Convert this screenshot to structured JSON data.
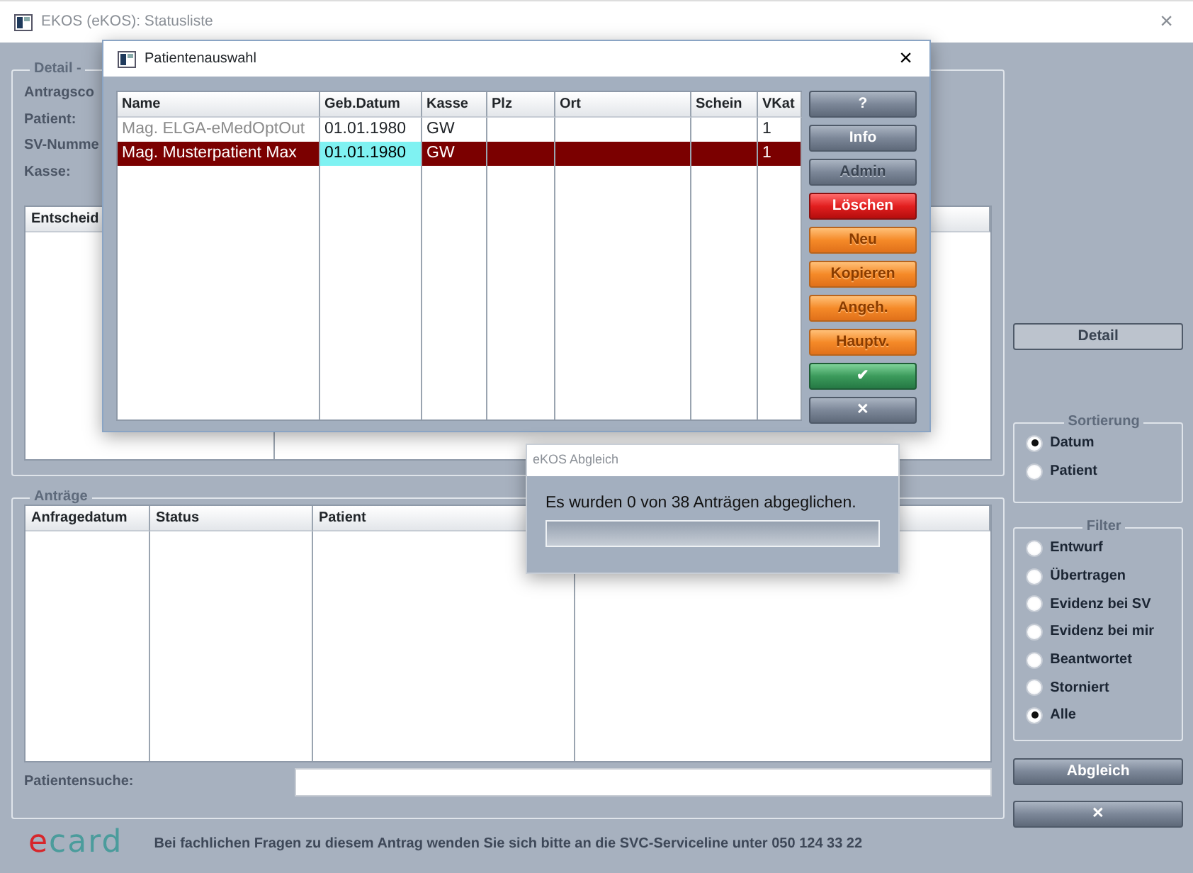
{
  "window": {
    "title": "EKOS (eKOS): Statusliste",
    "close": "×"
  },
  "detail_group": {
    "legend": "Detail -",
    "labels": [
      "Antragsco",
      "Patient:",
      "SV-Numme",
      "Kasse:"
    ],
    "table": {
      "columns": [
        "Entscheid"
      ]
    }
  },
  "antraege_group": {
    "legend": "Anträge",
    "table": {
      "columns": [
        "Anfragedatum",
        "Status",
        "Patient"
      ]
    },
    "search": {
      "label": "Patientensuche:"
    }
  },
  "footer": {
    "logo": "ecard",
    "text": "Bei fachlichen Fragen zu diesem Antrag wenden Sie sich bitte an die SVC-Serviceline unter 050 124 33 22"
  },
  "side": {
    "detail_button": {
      "label": "Detail",
      "disabled": true
    },
    "sort": {
      "legend": "Sortierung",
      "options": [
        {
          "label": "Datum",
          "selected": true
        },
        {
          "label": "Patient",
          "selected": false
        }
      ]
    },
    "filter": {
      "legend": "Filter",
      "options": [
        {
          "label": "Entwurf",
          "selected": false
        },
        {
          "label": "Übertragen",
          "selected": false
        },
        {
          "label": "Evidenz bei SV",
          "selected": false
        },
        {
          "label": "Evidenz bei mir",
          "selected": false
        },
        {
          "label": "Beantwortet",
          "selected": false
        },
        {
          "label": "Storniert",
          "selected": false
        },
        {
          "label": "Alle",
          "selected": true
        }
      ]
    },
    "buttons": [
      {
        "label": "Abgleich",
        "kind": "default",
        "disabled": false
      },
      {
        "label": "✕",
        "kind": "default",
        "disabled": false
      }
    ]
  },
  "patient_dialog": {
    "title": "Patientenauswahl",
    "close": "×",
    "columns": [
      "Name",
      "Geb.Datum",
      "Kasse",
      "Plz",
      "Ort",
      "Schein",
      "VKat"
    ],
    "rows": [
      {
        "cells": [
          "Mag. ELGA-eMedOptOut",
          "01.01.1980",
          "GW",
          "",
          "",
          "",
          "1"
        ],
        "selected": false,
        "muted": true
      },
      {
        "cells": [
          "Mag. Musterpatient Max",
          "01.01.1980",
          "GW",
          "",
          "",
          "",
          "1"
        ],
        "selected": true,
        "muted": false
      }
    ],
    "buttons": [
      {
        "label": "?",
        "kind": "default",
        "disabled": false
      },
      {
        "label": "Info",
        "kind": "default",
        "disabled": false
      },
      {
        "label": "Admin",
        "kind": "default",
        "disabled": true
      },
      {
        "label": "Löschen",
        "kind": "danger",
        "disabled": false
      },
      {
        "label": "Neu",
        "kind": "warning",
        "disabled": true
      },
      {
        "label": "Kopieren",
        "kind": "warning",
        "disabled": true
      },
      {
        "label": "Angeh.",
        "kind": "warning",
        "disabled": true
      },
      {
        "label": "Hauptv.",
        "kind": "warning",
        "disabled": true
      },
      {
        "label": "✔",
        "kind": "success",
        "disabled": false
      },
      {
        "label": "✕",
        "kind": "default",
        "disabled": false
      }
    ]
  },
  "sync_dialog": {
    "title": "eKOS Abgleich",
    "message": "Es wurden 0 von 38 Anträgen abgeglichen.",
    "progress": {
      "level": 0
    }
  }
}
